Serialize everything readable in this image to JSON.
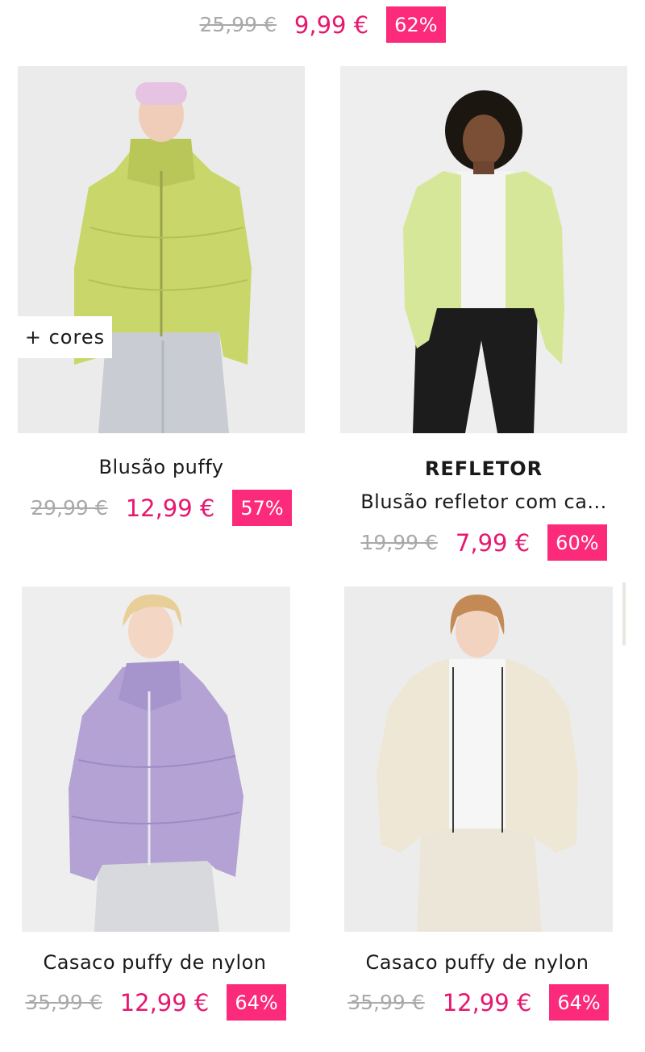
{
  "top_item": {
    "old_price": "25,99 €",
    "new_price": "9,99 €",
    "discount": "62%"
  },
  "products": [
    {
      "title": "Blusão puffy",
      "old_price": "29,99 €",
      "new_price": "12,99 €",
      "discount": "57%",
      "more_colors": "+ cores",
      "jacket_color": "#c9d76a"
    },
    {
      "brand": "REFLETOR",
      "title": "Blusão refletor com ca...",
      "old_price": "19,99 €",
      "new_price": "7,99 €",
      "discount": "60%",
      "jacket_color": "#d6e79a"
    },
    {
      "title": "Casaco puffy de nylon",
      "old_price": "35,99 €",
      "new_price": "12,99 €",
      "discount": "64%",
      "jacket_color": "#b3a2d3"
    },
    {
      "title": "Casaco puffy de nylon",
      "old_price": "35,99 €",
      "new_price": "12,99 €",
      "discount": "64%",
      "jacket_color": "#efe7d6"
    }
  ],
  "colors": {
    "sale_price": "#e6186f",
    "badge_bg": "#fb2a7a",
    "old_price": "#a9a9a9"
  }
}
